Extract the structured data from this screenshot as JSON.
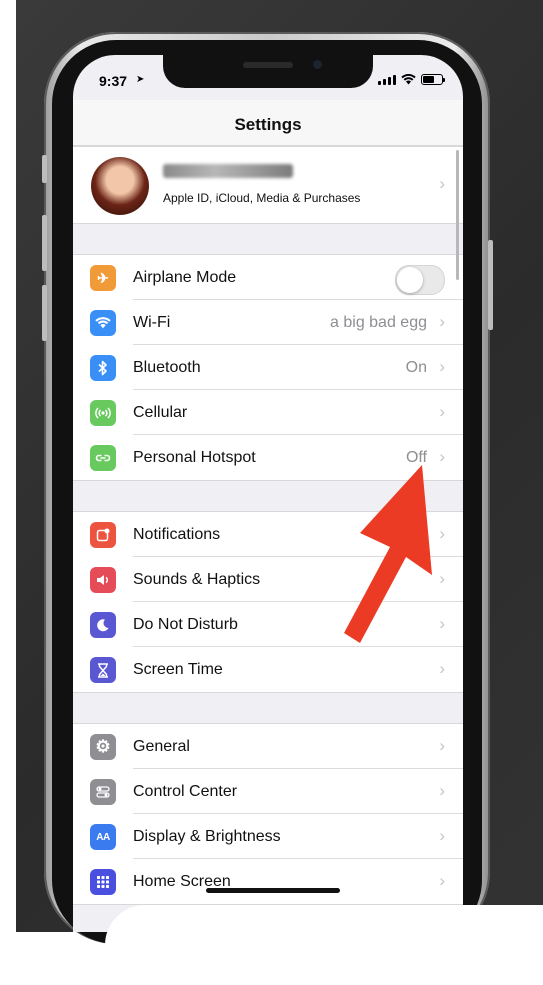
{
  "status": {
    "time": "9:37"
  },
  "nav": {
    "title": "Settings"
  },
  "profile": {
    "subtitle": "Apple ID, iCloud, Media & Purchases"
  },
  "groups": [
    {
      "rows": [
        {
          "label": "Airplane Mode",
          "icon": "airplane-icon",
          "color": "#f19a38",
          "value": "",
          "control": "toggle",
          "toggle_on": false
        },
        {
          "label": "Wi-Fi",
          "icon": "wifi-icon",
          "color": "#3a8ff6",
          "value": "a big bad egg"
        },
        {
          "label": "Bluetooth",
          "icon": "bluetooth-icon",
          "color": "#3a8ff6",
          "value": "On"
        },
        {
          "label": "Cellular",
          "icon": "cellular-icon",
          "color": "#67c95e",
          "value": ""
        },
        {
          "label": "Personal Hotspot",
          "icon": "hotspot-icon",
          "color": "#67c95e",
          "value": "Off"
        }
      ]
    },
    {
      "rows": [
        {
          "label": "Notifications",
          "icon": "notifications-icon",
          "color": "#ec5440",
          "value": ""
        },
        {
          "label": "Sounds & Haptics",
          "icon": "speaker-icon",
          "color": "#e64b58",
          "value": ""
        },
        {
          "label": "Do Not Disturb",
          "icon": "moon-icon",
          "color": "#5a57d2",
          "value": ""
        },
        {
          "label": "Screen Time",
          "icon": "hourglass-icon",
          "color": "#5a57d2",
          "value": ""
        }
      ]
    },
    {
      "rows": [
        {
          "label": "General",
          "icon": "gear-icon",
          "color": "#8e8e93",
          "value": ""
        },
        {
          "label": "Control Center",
          "icon": "switches-icon",
          "color": "#8e8e93",
          "value": ""
        },
        {
          "label": "Display & Brightness",
          "icon": "display-icon",
          "color": "#3a7bf0",
          "value": ""
        },
        {
          "label": "Home Screen",
          "icon": "home-grid-icon",
          "color": "#4a4fe0",
          "value": ""
        }
      ]
    }
  ],
  "annotation": {
    "arrow_color": "#ec3b24",
    "points_to": "Personal Hotspot"
  }
}
